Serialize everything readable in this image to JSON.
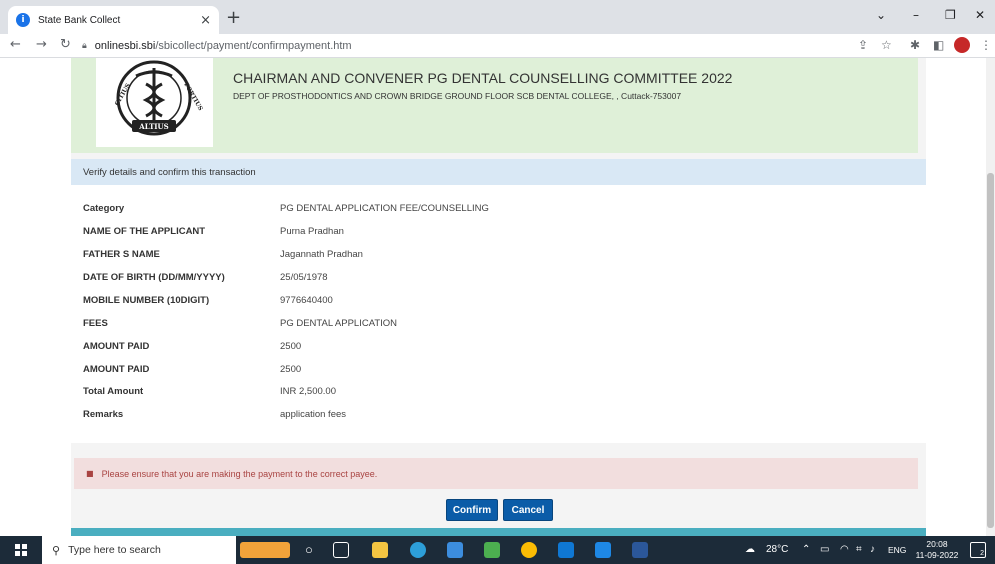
{
  "browser": {
    "tab_title": "State Bank Collect",
    "tab_close": "×",
    "new_tab": "+",
    "url_host": "onlinesbi.sbi",
    "url_path": "/sbicollect/payment/confirmpayment.htm",
    "window_controls": [
      "⌄",
      "–",
      "❐",
      "✕"
    ]
  },
  "header": {
    "org_name": "CHAIRMAN AND CONVENER PG DENTAL COUNSELLING COMMITTEE 2022",
    "org_address": "DEPT OF PROSTHODONTICS AND CROWN BRIDGE GROUND FLOOR SCB DENTAL COLLEGE, , Cuttack-753007",
    "logo_text": "CITIUS ALTIUS FORTIUS"
  },
  "verify_text": "Verify details and confirm this transaction",
  "details": [
    {
      "label": "Category",
      "value": "PG DENTAL APPLICATION FEE/COUNSELLING"
    },
    {
      "label": "NAME OF THE APPLICANT",
      "value": "Purna Pradhan"
    },
    {
      "label": "FATHER S NAME",
      "value": "Jagannath Pradhan"
    },
    {
      "label": "DATE OF BIRTH (DD/MM/YYYY)",
      "value": "25/05/1978"
    },
    {
      "label": "MOBILE NUMBER (10DIGIT)",
      "value": "9776640400"
    },
    {
      "label": "FEES",
      "value": "PG DENTAL APPLICATION"
    },
    {
      "label": "AMOUNT PAID",
      "value": "2500"
    },
    {
      "label": "AMOUNT PAID",
      "value": "2500"
    },
    {
      "label": "Total Amount",
      "value": "INR 2,500.00"
    },
    {
      "label": "Remarks",
      "value": "application fees"
    }
  ],
  "alert_text": "Please ensure that you are making the payment to the correct payee.",
  "buttons": {
    "confirm": "Confirm",
    "cancel": "Cancel"
  },
  "taskbar": {
    "search_placeholder": "Type here to search",
    "weather": "28°C",
    "language": "ENG",
    "time": "20:08",
    "date": "11-09-2022",
    "notification_count": "2"
  }
}
